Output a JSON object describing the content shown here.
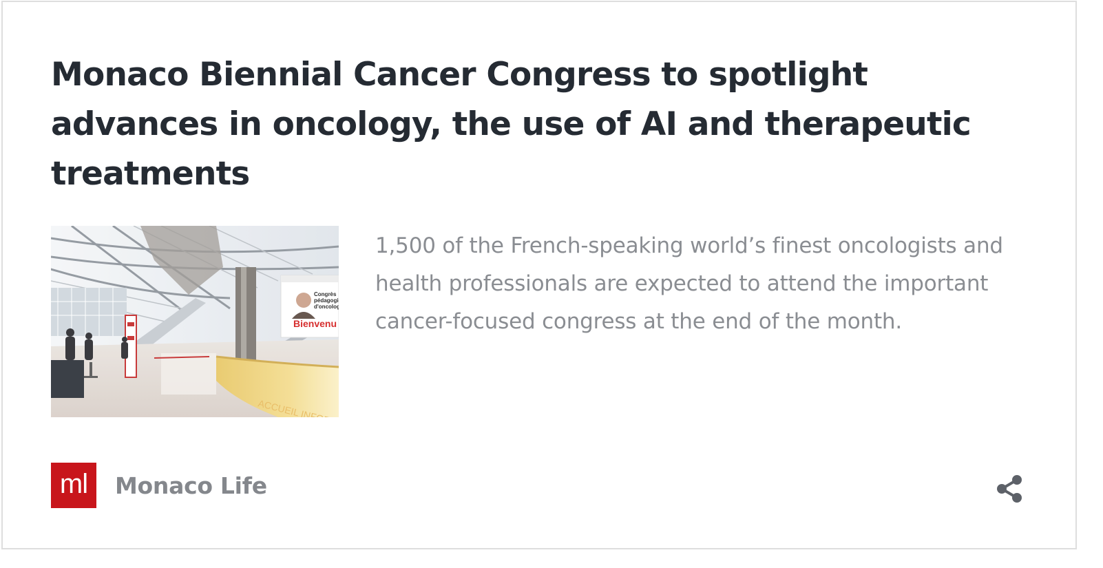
{
  "article": {
    "headline": "Monaco Biennial Cancer Congress to spotlight advances in oncology, the use of AI and therapeutic treatments",
    "summary": "1,500 of the French-speaking world’s finest oncologists and health professionals are expected to attend the important cancer-focused congress at the end of the month.",
    "image": {
      "sign_text": "Bienvenu",
      "banner_lines": [
        "Congrès",
        "pédagogique",
        "d'oncologie"
      ],
      "floor_text": "ACCUEIL INFORMATIC"
    }
  },
  "publisher": {
    "logo_text": "ml",
    "name": "Monaco Life",
    "logo_color": "#c8151b"
  },
  "actions": {
    "share_icon": "share-icon"
  },
  "colors": {
    "headline": "#252b33",
    "summary": "#8a8d92",
    "publisher_name": "#84878c",
    "border": "#dedede"
  }
}
